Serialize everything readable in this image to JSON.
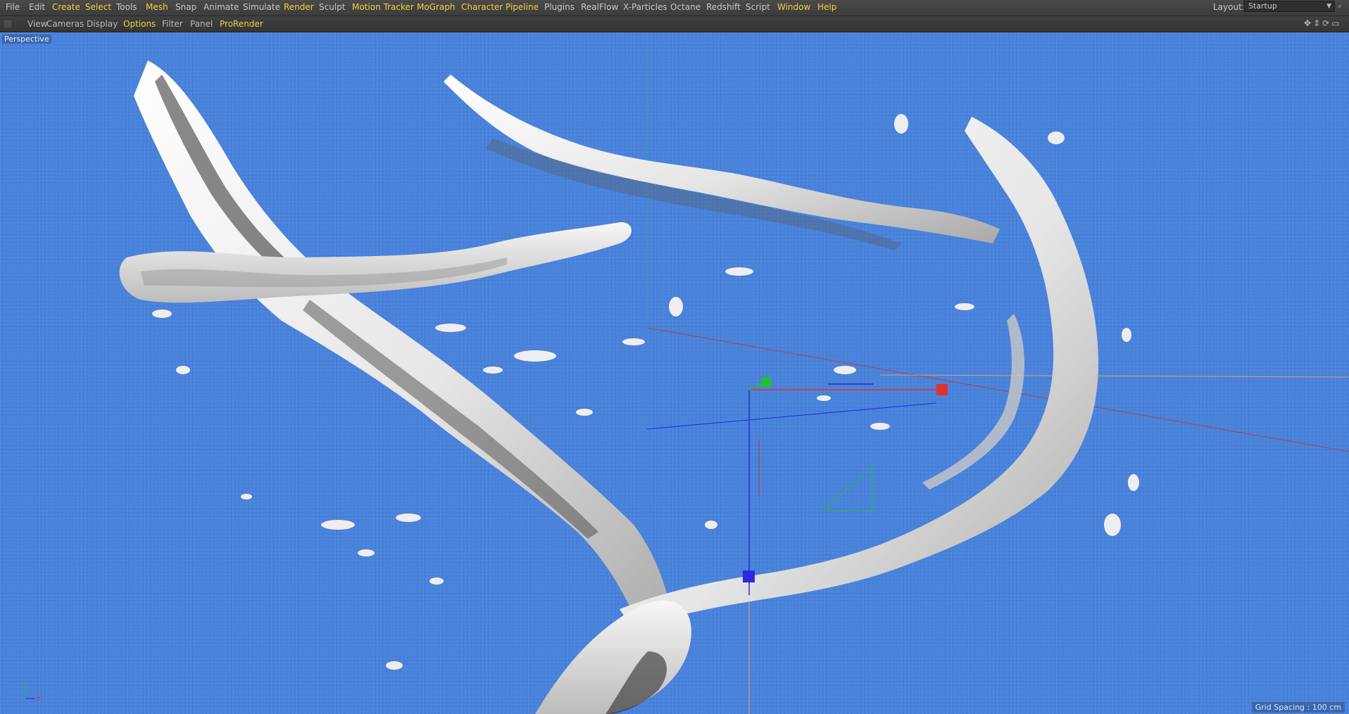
{
  "menubar": {
    "items": [
      {
        "label": "File",
        "highlight": false
      },
      {
        "label": "Edit",
        "highlight": false
      },
      {
        "label": "Create",
        "highlight": true
      },
      {
        "label": "Select",
        "highlight": true
      },
      {
        "label": "Tools",
        "highlight": false
      },
      {
        "label": "Mesh",
        "highlight": true
      },
      {
        "label": "Snap",
        "highlight": false
      },
      {
        "label": "Animate",
        "highlight": false
      },
      {
        "label": "Simulate",
        "highlight": false
      },
      {
        "label": "Render",
        "highlight": true
      },
      {
        "label": "Sculpt",
        "highlight": false
      },
      {
        "label": "Motion Tracker",
        "highlight": true
      },
      {
        "label": "MoGraph",
        "highlight": true
      },
      {
        "label": "Character",
        "highlight": true
      },
      {
        "label": "Pipeline",
        "highlight": true
      },
      {
        "label": "Plugins",
        "highlight": false
      },
      {
        "label": "RealFlow",
        "highlight": false
      },
      {
        "label": "X-Particles",
        "highlight": false
      },
      {
        "label": "Octane",
        "highlight": false
      },
      {
        "label": "Redshift",
        "highlight": false
      },
      {
        "label": "Script",
        "highlight": false
      },
      {
        "label": "Window",
        "highlight": true
      },
      {
        "label": "Help",
        "highlight": true
      }
    ],
    "layout_label": "Layout:",
    "layout_value": "Startup"
  },
  "viewbar": {
    "items": [
      {
        "label": "View",
        "highlight": false
      },
      {
        "label": "Cameras",
        "highlight": false
      },
      {
        "label": "Display",
        "highlight": false
      },
      {
        "label": "Options",
        "highlight": true
      },
      {
        "label": "Filter",
        "highlight": false
      },
      {
        "label": "Panel",
        "highlight": false
      },
      {
        "label": "ProRender",
        "highlight": true
      }
    ]
  },
  "viewport": {
    "camera_label": "Perspective",
    "grid_spacing": "Grid Spacing : 100 cm",
    "background_color": "#4a84dd",
    "axis_labels": {
      "z": "z"
    }
  },
  "colors": {
    "highlight_menu": "#f2d23a",
    "fluid": "#e9e9e9",
    "handle_x": "#e03030",
    "handle_y": "#22c030",
    "handle_z": "#2a2adc"
  }
}
